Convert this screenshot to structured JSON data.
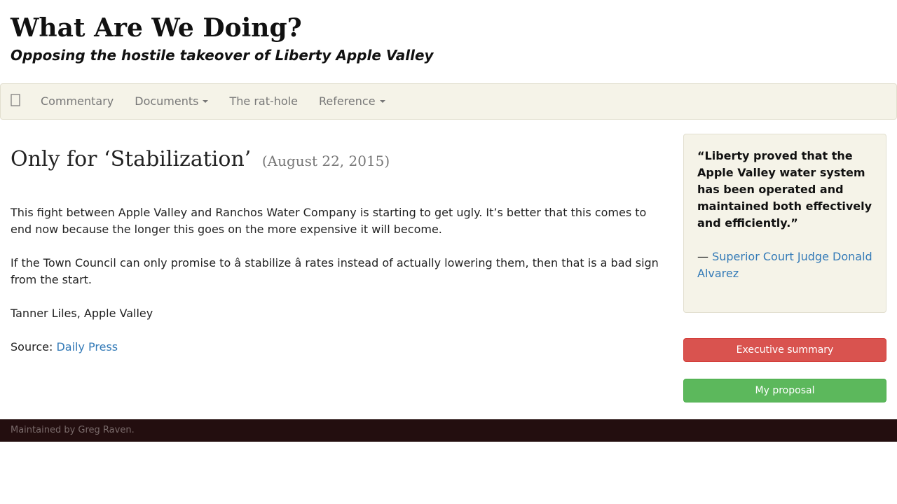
{
  "header": {
    "title": "What Are We Doing?",
    "tagline": "Opposing the hostile takeover of Liberty Apple Valley"
  },
  "nav": {
    "home_icon": "home-icon",
    "items": [
      {
        "label": "Commentary",
        "dropdown": false
      },
      {
        "label": "Documents",
        "dropdown": true
      },
      {
        "label": "The rat-hole",
        "dropdown": false
      },
      {
        "label": "Reference",
        "dropdown": true
      }
    ]
  },
  "post": {
    "title": "Only for ‘Stabilization’",
    "date": "(August 22, 2015)",
    "paragraphs": [
      "This fight between Apple Valley and Ranchos Water Company is starting to get ugly. It’s better that this comes to end now because the longer this goes on the more expensive it will become.",
      "If the Town Council can only promise to â stabilize â rates instead of actually lowering them, then that is a bad sign from the start.",
      "Tanner Liles, Apple Valley"
    ],
    "source_label": "Source: ",
    "source_link": "Daily Press"
  },
  "sidebar": {
    "quote": "“Liberty proved that the Apple Valley water system has been operated and maintained both effectively and efficiently.”",
    "attribution_dash": "— ",
    "attribution_link": "Superior Court Judge Donald Alvarez",
    "buttons": {
      "executive_summary": "Executive summary",
      "my_proposal": "My proposal"
    }
  },
  "footer": {
    "text": "Maintained by Greg Raven."
  },
  "colors": {
    "navbar_bg": "#f5f3e8",
    "link": "#337ab7",
    "danger": "#d9534f",
    "success": "#5cb85c",
    "footer_bg": "#230e0f"
  }
}
